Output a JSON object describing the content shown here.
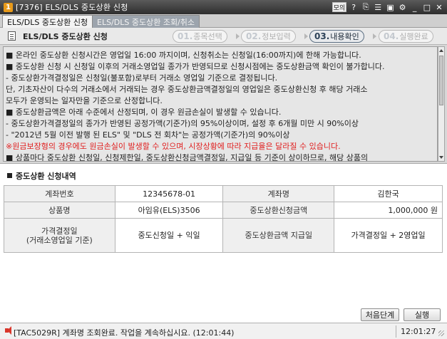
{
  "window": {
    "title": "[7376] ELS/DLS 중도상환 신청",
    "app_icon_text": "1",
    "controls": [
      "모의",
      "?",
      "⎘",
      "☰",
      "▣",
      "⚙",
      "_",
      "□",
      "✕"
    ]
  },
  "tabs": [
    {
      "label": "ELS/DLS 중도상환 신청",
      "active": true
    },
    {
      "label": "ELS/DLS 중도상환 조회/취소",
      "active": false
    }
  ],
  "header": {
    "title": "ELS/DLS 중도상환 신청",
    "steps": [
      {
        "num": "01.",
        "label": "종목선택",
        "active": false
      },
      {
        "num": "02.",
        "label": "정보입력",
        "active": false
      },
      {
        "num": "03.",
        "label": "내용확인",
        "active": true
      },
      {
        "num": "04.",
        "label": "실행완료",
        "active": false
      }
    ]
  },
  "notice": {
    "lines": [
      "■ 온라인 중도상환 신청시간은 영업일 16:00 까지이며, 신청취소는 신청일(16:00까지)에 한해 가능합니다.",
      "■ 중도상환 신청 시 신청일 이후의 거래소영업일 종가가 반영되므로 신청시점에는 중도상환금액 확인이 불가합니다.",
      "  - 중도상환가격결정일은 신청일(불포함)로부터 거래소 영업일 기준으로 결정됩니다.",
      "       단, 기초자산이 다수의 거래소에서 거래되는 경우 중도상환금액결정일의 영업일은 중도상환신청 후 해당 거래소",
      "       모두가 운영되는 일자만을 기준으로 산정합니다.",
      "■ 중도상환금액은 아래 수준에서 산정되며, 이 경우 원금손실이 발생할 수 있습니다.",
      "  - 중도상환가격결정일의 종가가 반영된 공정가액(기준가)의 95%이상이며, 설정 후 6개월 미만 시 90%이상",
      "  - \"2012년 5월 이전 발행 된 ELS\" 및 \"DLS 전 회차\"는 공정가액(기준가)의 90%이상",
      "   ※원금보장형의 경우에도 원금손실이 발생할 수 있으며, 시장상황에 따라 지급율은 달라질 수 있습니다.",
      "■ 상품마다 중도상환 신청일, 신청제한일, 중도상환신청금액결정일, 지급일 등 기준이 상이하므로, 해당 상품의"
    ],
    "red_line_index": 8
  },
  "section": {
    "title": "중도상환 신청내역"
  },
  "details": {
    "account_no_label": "계좌번호",
    "account_no": "12345678-01",
    "account_name_label": "계좌명",
    "account_name": "김한국",
    "product_label": "상품명",
    "product": "아임유(ELS)3506",
    "amount_label": "중도상환신청금액",
    "amount": "1,000,000 원",
    "price_date_label_1": "가격결정일",
    "price_date_label_2": "(거래소영업일 기준)",
    "price_date": "중도신청일 + 익일",
    "pay_date_label": "중도상환금액 지급일",
    "pay_date": "가격결정일 + 2영업일"
  },
  "buttons": {
    "first_step": "처음단계",
    "execute": "실행"
  },
  "status": {
    "message": "[TAC5029R] 계좌명 조회완료. 작업을 계속하십시요. (12:01:44)",
    "clock": "12:01:27"
  }
}
